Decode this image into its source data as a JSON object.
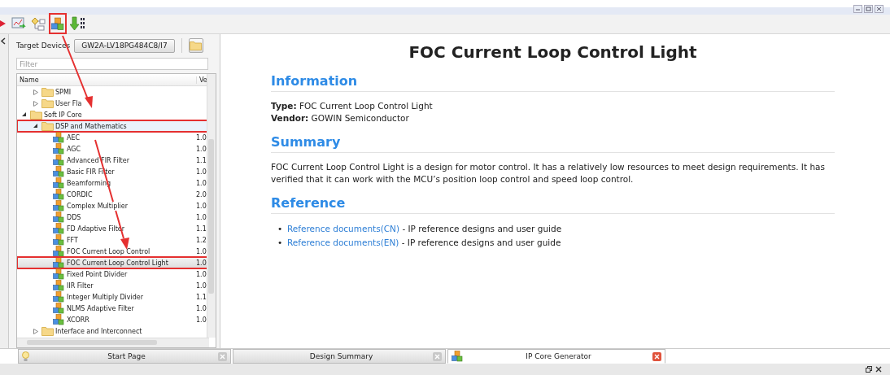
{
  "toolbar": {
    "buttons": [
      {
        "kind": "partial",
        "highlighted": false
      },
      {
        "kind": "chart",
        "highlighted": false
      },
      {
        "kind": "flow",
        "highlighted": false
      },
      {
        "kind": "cubes",
        "highlighted": true
      },
      {
        "kind": "download",
        "highlighted": false
      }
    ]
  },
  "target_device": {
    "label": "Target Devices",
    "value": "GW2A-LV18PG484C8/I7"
  },
  "filter": {
    "placeholder": "Filter"
  },
  "tree": {
    "columns": [
      "Name",
      "Ve"
    ],
    "items": [
      {
        "children": [
          {
            "kind": "folder",
            "label": "SPMI",
            "expanded": false,
            "selected": false,
            "highlighted": false
          },
          {
            "kind": "folder",
            "label": "User Fla",
            "expanded": false,
            "selected": false,
            "highlighted": false
          }
        ]
      },
      {
        "kind": "folder",
        "label": "Soft IP Core",
        "expanded": true,
        "selected": false,
        "highlighted": false,
        "children": [
          {
            "kind": "folder",
            "label": "DSP and Mathematics",
            "expanded": true,
            "selected": false,
            "highlighted": true,
            "children": [
              {
                "kind": "ip",
                "label": "AEC",
                "version": "1.0",
                "selected": false,
                "highlighted": false
              },
              {
                "kind": "ip",
                "label": "AGC",
                "version": "1.0",
                "selected": false,
                "highlighted": false
              },
              {
                "kind": "ip",
                "label": "Advanced FIR Filter",
                "version": "1.1",
                "selected": false,
                "highlighted": false
              },
              {
                "kind": "ip",
                "label": "Basic FIR Filter",
                "version": "1.0",
                "selected": false,
                "highlighted": false
              },
              {
                "kind": "ip",
                "label": "Beamforming",
                "version": "1.0",
                "selected": false,
                "highlighted": false
              },
              {
                "kind": "ip",
                "label": "CORDIC",
                "version": "2.0",
                "selected": false,
                "highlighted": false
              },
              {
                "kind": "ip",
                "label": "Complex Multiplier",
                "version": "1.0",
                "selected": false,
                "highlighted": false
              },
              {
                "kind": "ip",
                "label": "DDS",
                "version": "1.0",
                "selected": false,
                "highlighted": false
              },
              {
                "kind": "ip",
                "label": "FD Adaptive Filter",
                "version": "1.1",
                "selected": false,
                "highlighted": false
              },
              {
                "kind": "ip",
                "label": "FFT",
                "version": "1.2",
                "selected": false,
                "highlighted": false
              },
              {
                "kind": "ip",
                "label": "FOC Current Loop Control",
                "version": "1.0",
                "selected": false,
                "highlighted": false
              },
              {
                "kind": "ip",
                "label": "FOC Current Loop Control Light",
                "version": "1.0",
                "selected": true,
                "highlighted": true
              },
              {
                "kind": "ip",
                "label": "Fixed Point Divider",
                "version": "1.0",
                "selected": false,
                "highlighted": false
              },
              {
                "kind": "ip",
                "label": "IIR Filter",
                "version": "1.0",
                "selected": false,
                "highlighted": false
              },
              {
                "kind": "ip",
                "label": "Integer Multiply Divider",
                "version": "1.1",
                "selected": false,
                "highlighted": false
              },
              {
                "kind": "ip",
                "label": "NLMS Adaptive Filter",
                "version": "1.0",
                "selected": false,
                "highlighted": false
              },
              {
                "kind": "ip",
                "label": "XCORR",
                "version": "1.0",
                "selected": false,
                "highlighted": false
              }
            ]
          },
          {
            "kind": "folder",
            "label": "Interface and Interconnect",
            "expanded": false,
            "selected": false,
            "highlighted": false
          }
        ]
      }
    ]
  },
  "document": {
    "title": "FOC Current Loop Control Light",
    "sections": [
      {
        "heading": "Information",
        "kind": "fields",
        "lines": [
          "**Type:** FOC Current Loop Control Light",
          "**Vendor:** GOWIN Semiconductor"
        ]
      },
      {
        "heading": "Summary",
        "kind": "paragraph",
        "text": "FOC Current Loop Control Light is a design for motor control. It has a relatively low resources to meet design requirements. It has verified that it can work with the MCU’s position loop control and speed loop control."
      },
      {
        "heading": "Reference",
        "kind": "links",
        "items": [
          {
            "bullet": "•",
            "link": "Reference documents(CN)",
            "text": " - IP reference designs and user guide"
          },
          {
            "bullet": "•",
            "link": "Reference documents(EN)",
            "text": " - IP reference designs and user guide"
          }
        ]
      }
    ]
  },
  "tabs": [
    {
      "label": "Start Page",
      "kind": "start",
      "selected": false
    },
    {
      "label": "Design Summary",
      "kind": "summary",
      "selected": false
    },
    {
      "label": "IP Core Generator",
      "kind": "generator",
      "selected": true
    }
  ]
}
